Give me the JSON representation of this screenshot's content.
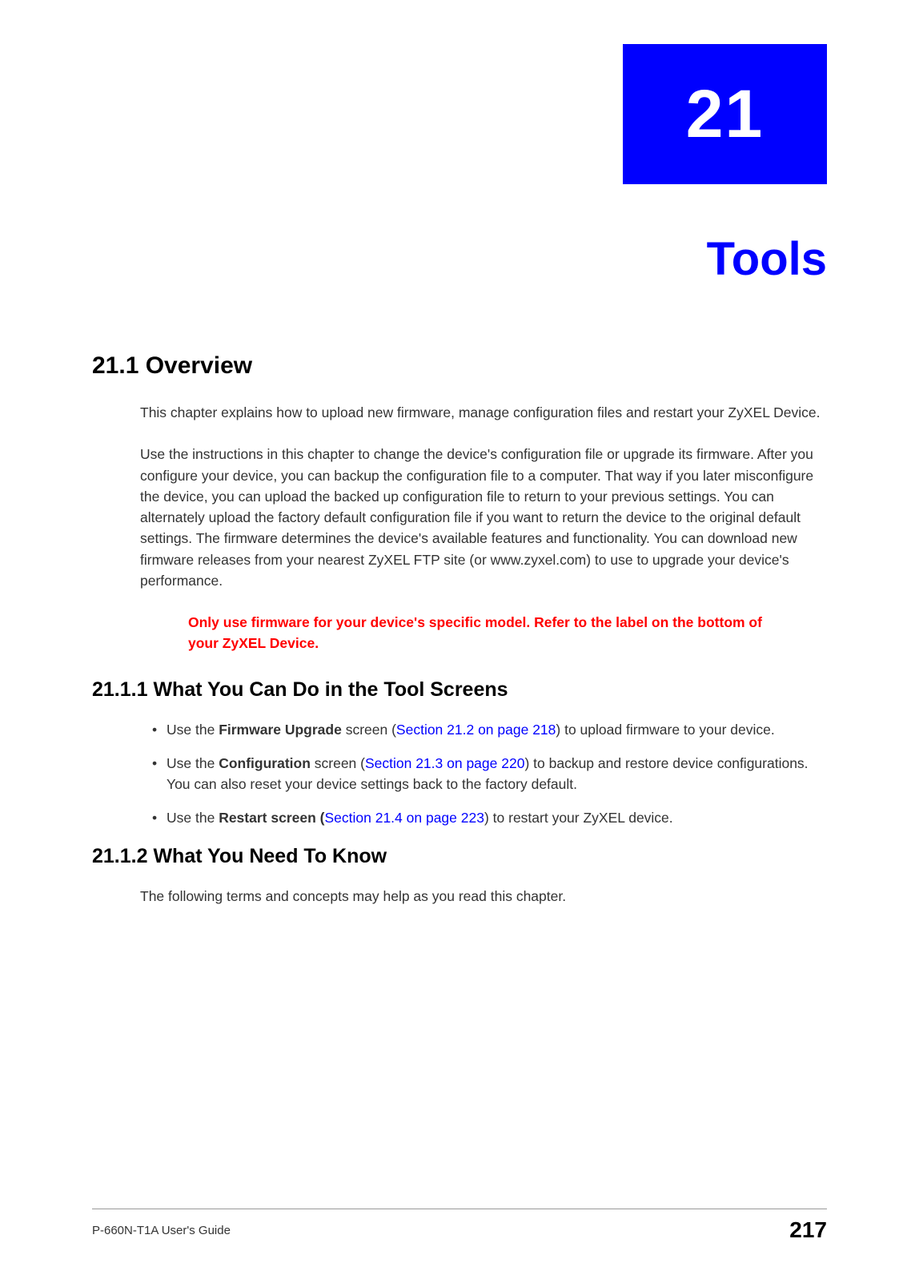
{
  "chapter": {
    "number": "21",
    "title": "Tools"
  },
  "sections": {
    "overview": {
      "heading": "21.1  Overview",
      "para1": "This chapter explains how to upload new firmware, manage configuration files and restart your ZyXEL Device.",
      "para2": "Use the instructions in this chapter to change the device's configuration file or upgrade its firmware. After you configure your device, you can backup the configuration file to a computer. That way if you later misconfigure the device, you can upload the backed up configuration file to return to your previous settings. You can alternately upload the factory default configuration file if you want to return the device to the original default settings. The firmware determines the device's available features and functionality. You can download new firmware releases from your nearest ZyXEL FTP site (or www.zyxel.com) to use to upgrade your device's performance.",
      "warning": "Only use firmware for your device's specific model. Refer to the label on the bottom of your ZyXEL Device."
    },
    "canDo": {
      "heading": "21.1.1  What You Can Do in the Tool Screens",
      "bullets": {
        "b1": {
          "pre": "Use the ",
          "bold": "Firmware Upgrade",
          "mid": " screen (",
          "link": "Section 21.2 on page 218",
          "post": ") to upload firmware to your device."
        },
        "b2": {
          "pre": "Use the ",
          "bold": "Configuration",
          "mid": " screen (",
          "link": "Section 21.3 on page 220",
          "post": ") to backup and restore device configurations. You can also reset your device settings back to the factory default."
        },
        "b3": {
          "pre": "Use the ",
          "bold": "Restart",
          "mid": " screen (",
          "link": "Section 21.4 on page 223",
          "post": ") to restart your ZyXEL device."
        }
      }
    },
    "needToKnow": {
      "heading": "21.1.2  What You Need To Know",
      "para": "The following terms and concepts may help as you read this chapter."
    }
  },
  "footer": {
    "guide": "P-660N-T1A User's Guide",
    "page": "217"
  }
}
